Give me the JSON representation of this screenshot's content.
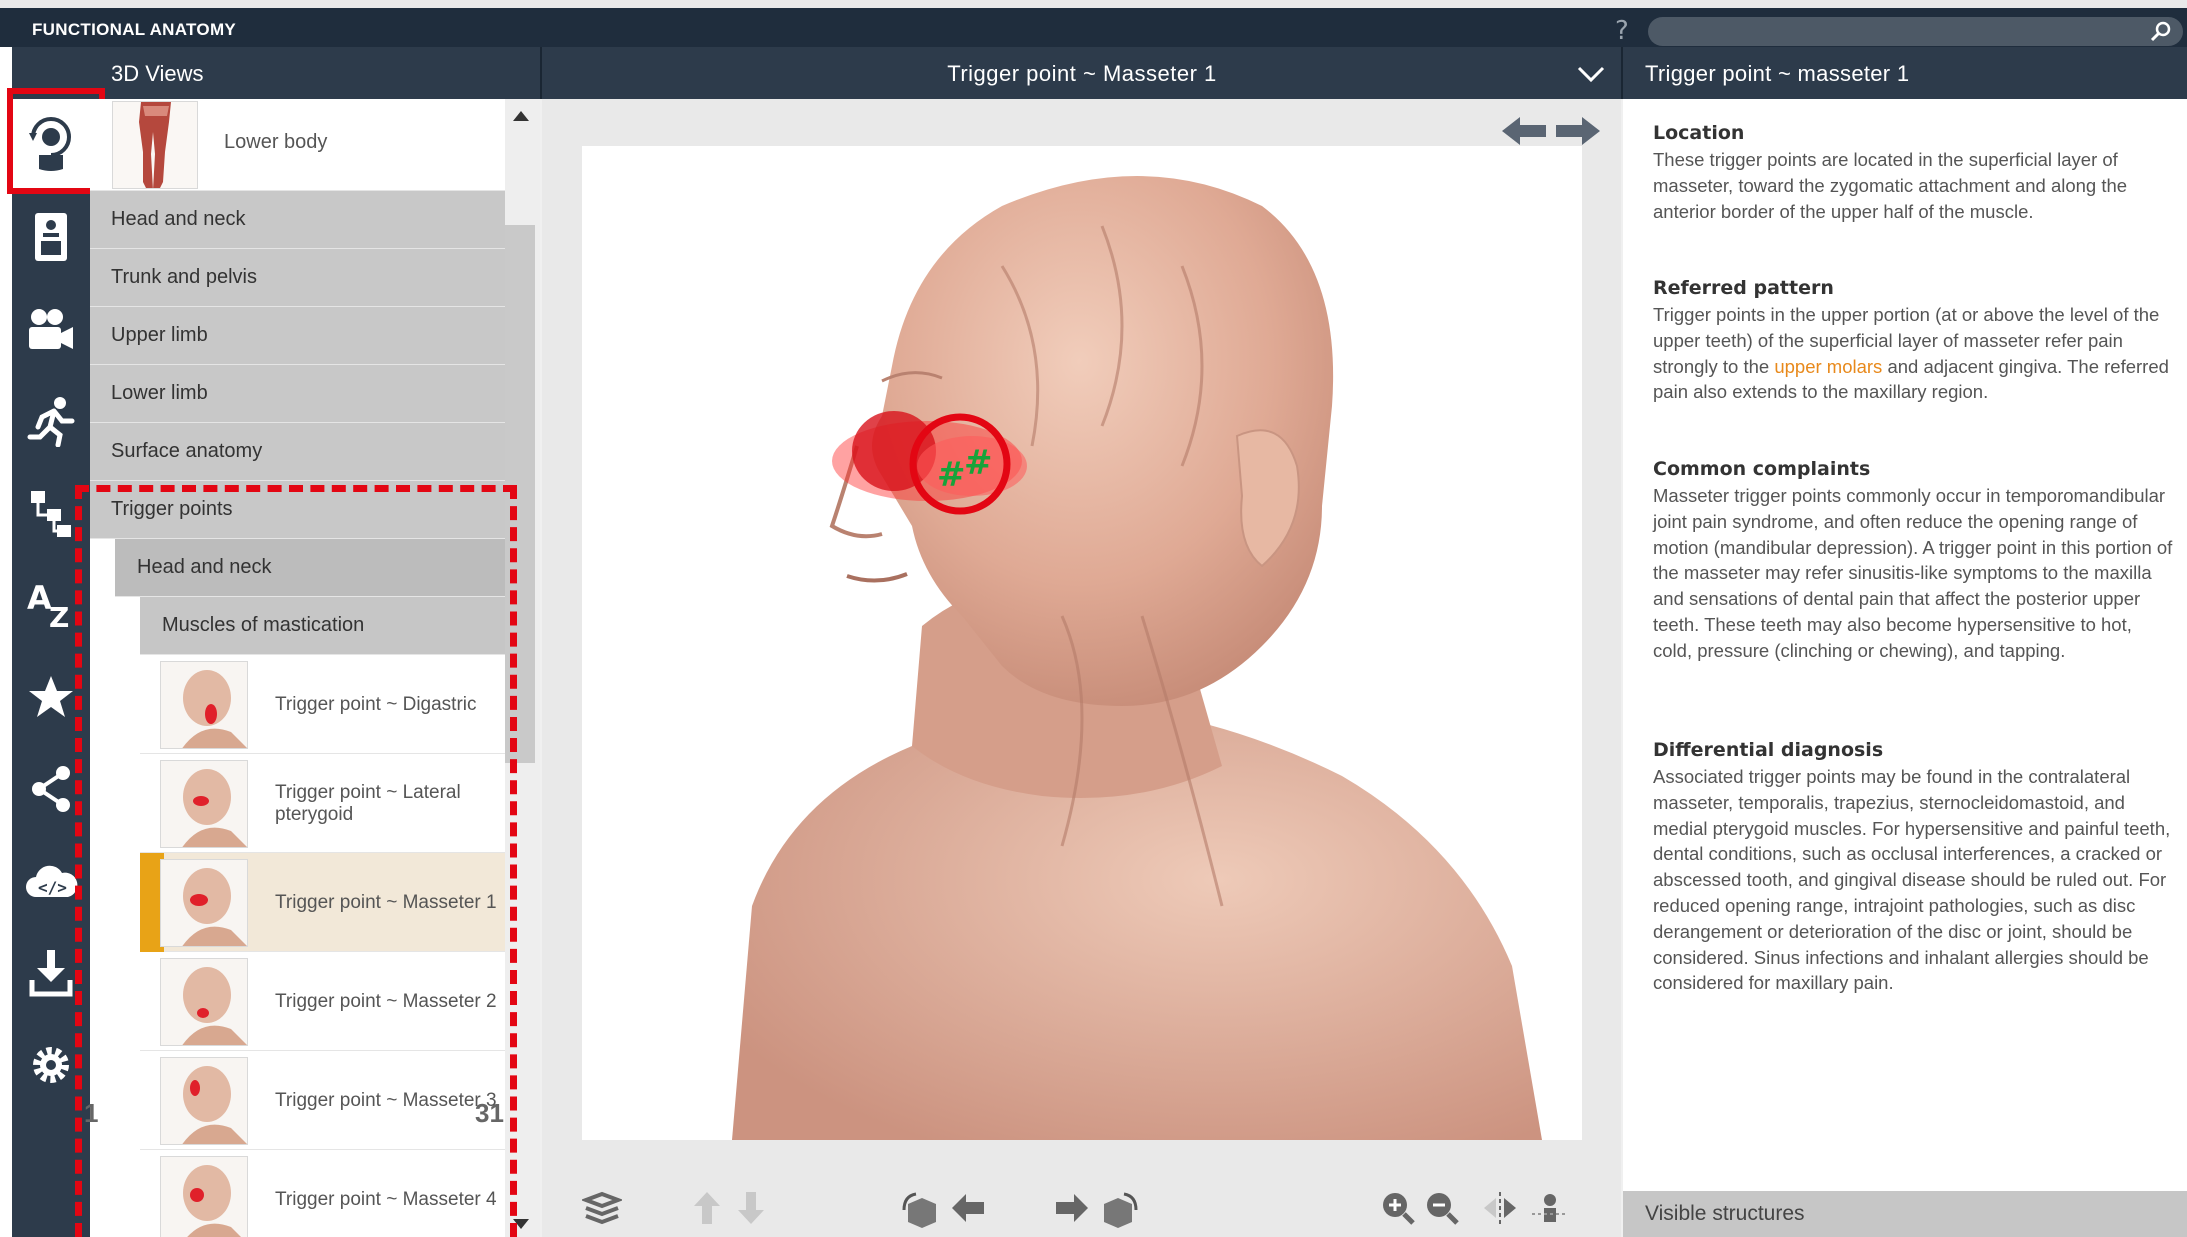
{
  "app": {
    "title": "FUNCTIONAL ANATOMY",
    "help": "?"
  },
  "search": {
    "placeholder": ""
  },
  "panels": {
    "views_title": "3D Views",
    "view_title": "Trigger point ~ Masseter 1",
    "info_title": "Trigger point ~ masseter 1"
  },
  "rail": {
    "icons": [
      "3d-views-icon",
      "atlas-icon",
      "video-icon",
      "running-man-icon",
      "hierarchy-icon",
      "a-z-icon",
      "star-icon",
      "share-icon",
      "cloud-code-icon",
      "download-icon",
      "gear-icon"
    ]
  },
  "tree": {
    "lower_body": "Lower body",
    "categories": [
      "Head and neck",
      "Trunk and pelvis",
      "Upper limb",
      "Lower limb",
      "Surface anatomy",
      "Trigger points"
    ],
    "sub": "Head and neck",
    "subsub": "Muscles of mastication",
    "items": [
      {
        "label": "Trigger point ~ Digastric"
      },
      {
        "label": "Trigger point ~ Lateral pterygoid"
      },
      {
        "label": "Trigger point ~ Masseter 1",
        "selected": true
      },
      {
        "label": "Trigger point ~ Masseter 2"
      },
      {
        "label": "Trigger point ~ Masseter 3"
      },
      {
        "label": "Trigger point ~ Masseter 4"
      }
    ]
  },
  "viewer": {
    "layer_count": "1",
    "frame_count": "31"
  },
  "info": {
    "sections": [
      {
        "heading": "Location",
        "text": "These trigger points are located in the superficial layer of masseter, toward the zygomatic attachment and along the anterior border of the upper half of the muscle."
      },
      {
        "heading": "Referred pattern",
        "text_before": "Trigger points in the upper portion (at or above the level of the upper teeth) of the superficial layer of masseter refer pain strongly to the ",
        "link": "upper molars",
        "text_after": " and adjacent gingiva. The referred pain also extends to the maxillary region."
      },
      {
        "heading": "Common complaints",
        "text": "Masseter trigger points commonly occur in temporomandibular joint pain syndrome, and often reduce the opening range of motion (mandibular depression). A trigger point in this portion of the masseter may refer sinusitis-like symptoms to the maxilla and sensations of dental pain that affect the posterior upper teeth. These teeth may also become hypersensitive to hot, cold, pressure (clinching or chewing), and tapping."
      },
      {
        "heading": "Differential diagnosis",
        "text": "Associated trigger points may be found in the contralateral masseter, temporalis, trapezius, sternocleidomastoid, and medial pterygoid muscles. For hypersensitive and painful teeth, dental conditions, such as occlusal interferences, a cracked or abscessed tooth, and gingival disease should be ruled out. For reduced opening range, intrajoint pathologies, such as disc derangement or deterioration of the disc or joint, should be considered. Sinus infections and inhalant allergies should be considered for maxillary pain."
      }
    ],
    "footer": "Visible structures"
  },
  "colors": {
    "header": "#2d3b4b",
    "topbar": "#1f2d3d",
    "annotation_red": "#e30613",
    "selected_accent": "#e8a317",
    "link_orange": "#e8891b"
  }
}
